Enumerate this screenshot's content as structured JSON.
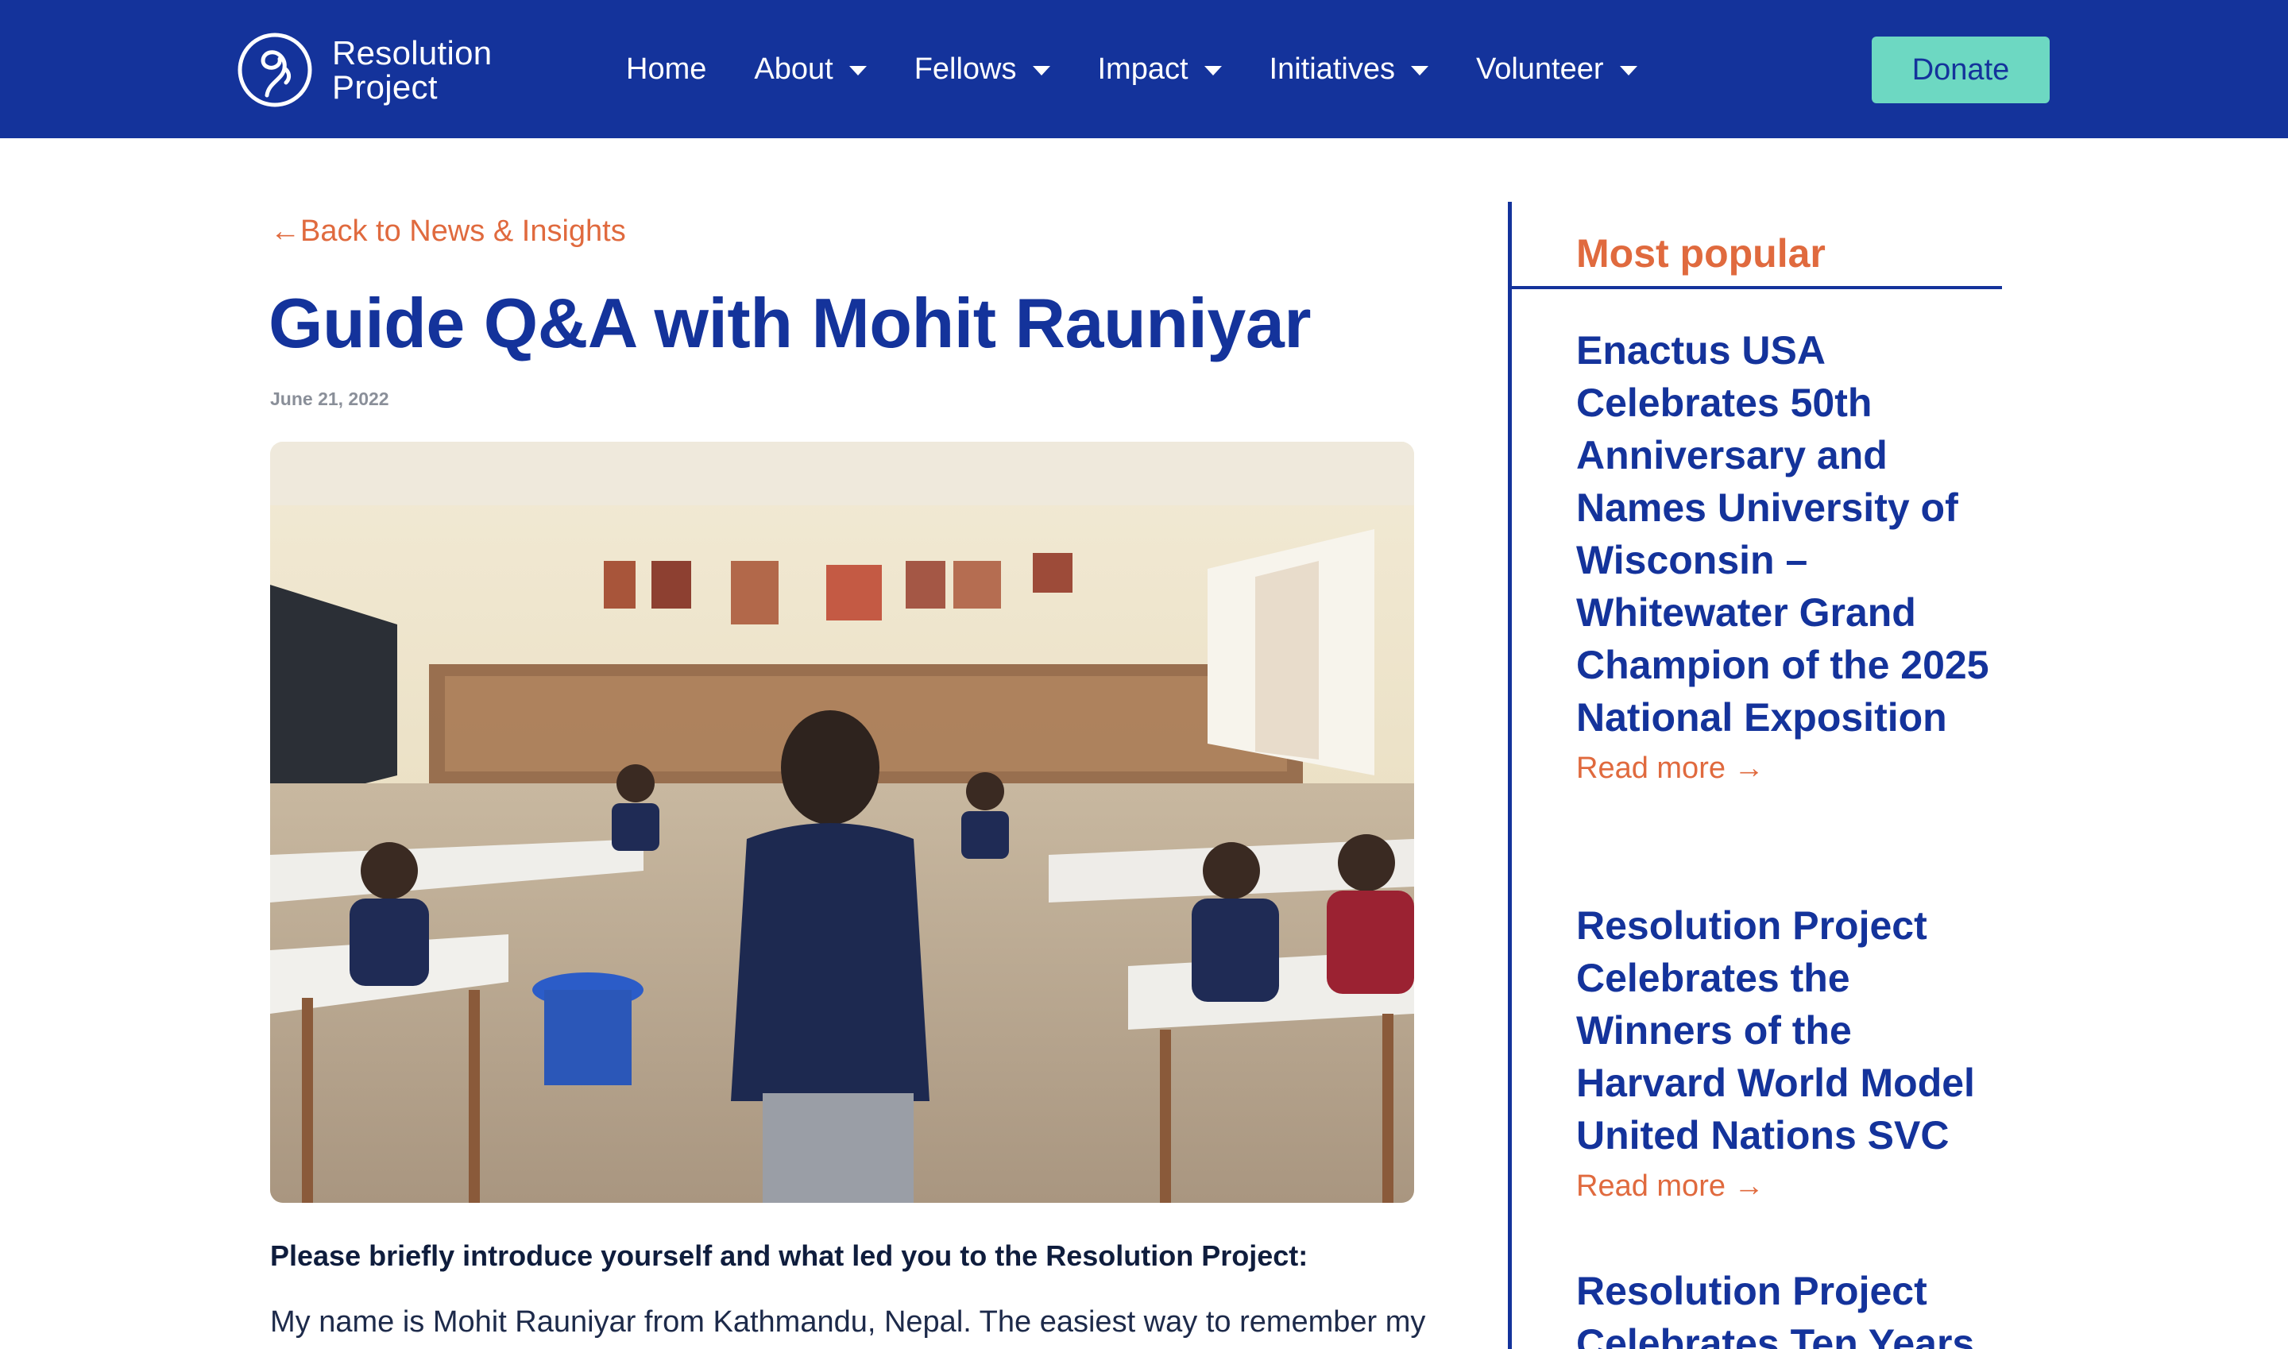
{
  "header": {
    "logo": {
      "line1": "Resolution",
      "line2": "Project"
    },
    "nav": [
      {
        "label": "Home",
        "has_dropdown": false
      },
      {
        "label": "About",
        "has_dropdown": true
      },
      {
        "label": "Fellows",
        "has_dropdown": true
      },
      {
        "label": "Impact",
        "has_dropdown": true
      },
      {
        "label": "Initiatives",
        "has_dropdown": true
      },
      {
        "label": "Volunteer",
        "has_dropdown": true
      }
    ],
    "donate_label": "Donate"
  },
  "article": {
    "back_link": "←Back to News & Insights",
    "title": "Guide Q&A with Mohit Rauniyar",
    "date": "June 21, 2022",
    "question": "Please briefly introduce yourself and what led you to the Resolution Project:",
    "paragraph": "My name is Mohit Rauniyar from Kathmandu, Nepal. The easiest way to remember my"
  },
  "sidebar": {
    "heading": "Most popular",
    "posts": [
      {
        "title": "Enactus USA Celebrates 50th Anniversary and Names University of Wisconsin – Whitewater Grand Champion of the 2025 National Exposition",
        "read_more": "Read more →"
      },
      {
        "title": "Resolution Project Celebrates the Winners of the Harvard World Model United Nations SVC",
        "read_more": "Read more →"
      },
      {
        "title": "Resolution Project Celebrates Ten Years",
        "read_more": ""
      }
    ]
  },
  "colors": {
    "header_bg": "#14339b",
    "accent_orange": "#e06a3e",
    "donate_bg": "#6dd8c2",
    "title_blue": "#14339b"
  },
  "icons": [
    "resolution-project-logo-icon",
    "caret-down-icon"
  ]
}
